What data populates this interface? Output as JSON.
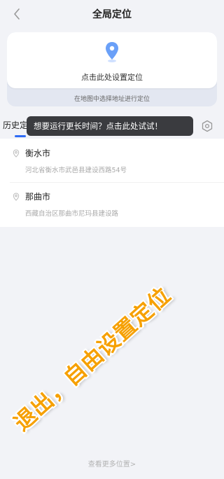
{
  "header": {
    "title": "全局定位",
    "back_icon": "chevron-left-icon"
  },
  "location_card": {
    "pin_icon": "location-pin-icon",
    "set_label": "点击此处设置定位",
    "sub_label": "在地图中选择地址进行定位"
  },
  "tabs": {
    "history_label": "历史定位",
    "active_color": "#2f6cf5"
  },
  "tooltip": {
    "text": "想要运行更长时间？点击此处试试！"
  },
  "settings_icon": "settings-icon",
  "history": [
    {
      "name": "衡水市",
      "address": "河北省衡水市武邑县建设西路54号"
    },
    {
      "name": "那曲市",
      "address": "西藏自治区那曲市尼玛县建设路"
    }
  ],
  "more_link": "查看更多位置>",
  "watermark": "退出，自由设置定位"
}
